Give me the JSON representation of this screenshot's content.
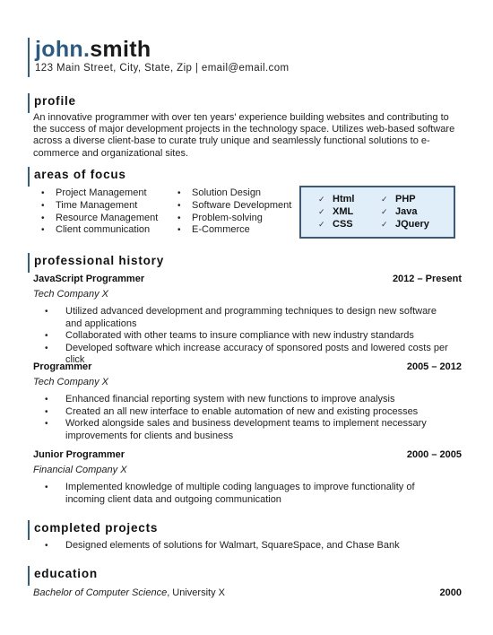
{
  "header": {
    "first_name": "john",
    "dot": ".",
    "last_name": "smith",
    "contact": "123 Main Street, City, State, Zip | email@email.com"
  },
  "profile": {
    "heading": "profile",
    "text": "An innovative programmer with over ten years' experience building websites and contributing to the success of major development projects in the technology space. Utilizes web-based software across a diverse client-base to curate truly unique and seamlessly functional solutions to e-commerce and organizational sites."
  },
  "focus": {
    "heading": "areas of focus",
    "col1": [
      "Project Management",
      "Time Management",
      "Resource Management",
      "Client communication"
    ],
    "col2": [
      "Solution Design",
      "Software Development",
      "Problem-solving",
      "E-Commerce"
    ],
    "skills_col1": [
      "Html",
      "XML",
      "CSS"
    ],
    "skills_col2": [
      "PHP",
      "Java",
      "JQuery"
    ],
    "check_icon": "✓"
  },
  "history": {
    "heading": "professional history",
    "jobs": [
      {
        "title": "JavaScript Programmer",
        "dates": "2012 – Present",
        "company": "Tech Company X",
        "bullets": [
          "Utilized advanced development and programming techniques to design new software and applications",
          "Collaborated with other teams to insure compliance with new industry standards",
          "Developed software which increase accuracy of sponsored posts and lowered costs per click"
        ]
      },
      {
        "title": "Programmer",
        "dates": "2005 – 2012",
        "company": "Tech Company X",
        "bullets": [
          "Enhanced financial reporting system with new functions to improve analysis",
          "Created an all new interface to enable automation of new and existing processes",
          "Worked alongside sales and business development teams to implement necessary improvements for clients and business"
        ]
      },
      {
        "title": "Junior Programmer",
        "dates": "2000 – 2005",
        "company": "Financial Company X",
        "bullets": [
          "Implemented knowledge of multiple coding languages to improve functionality of incoming client data and outgoing communication"
        ]
      }
    ]
  },
  "projects": {
    "heading": "completed projects",
    "bullets": [
      "Designed elements of solutions for Walmart, SquareSpace, and Chase Bank"
    ]
  },
  "education": {
    "heading": "education",
    "degree": "Bachelor of Computer Science",
    "school": ", University X",
    "year": "2000"
  },
  "colors": {
    "accent": "#2a5b86",
    "skills_box_bg": "#dfeef8",
    "skills_box_border": "#3a5a78"
  }
}
